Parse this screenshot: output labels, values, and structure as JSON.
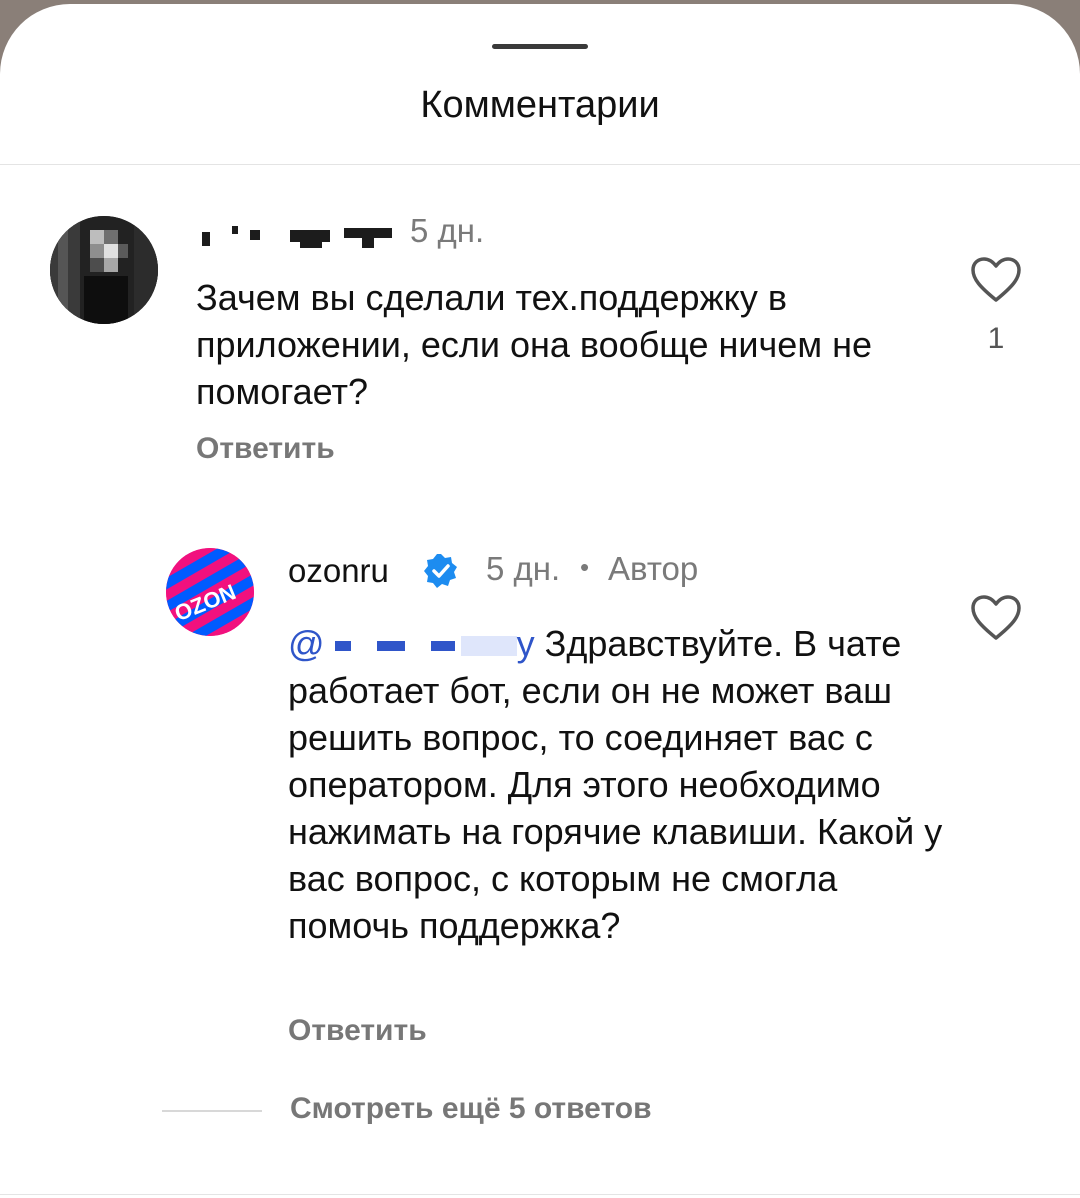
{
  "header": {
    "title": "Комментарии"
  },
  "comments": [
    {
      "username": "",
      "time": "5 дн.",
      "text": "Зачем вы сделали тех.поддержку в приложении, если она вообще ничем не помогает?",
      "reply_label": "Ответить",
      "likes": "1",
      "like_icon": "heart-outline-icon"
    },
    {
      "username": "ozonru",
      "verified_icon": "verified-badge-icon",
      "time": "5 дн.",
      "separator": "•",
      "author_label": "Автор",
      "mention_prefix": "@",
      "mention_tail": "у",
      "text": "Здравствуйте. В чате работает бот, если он не может ваш решить вопрос, то соединяет вас с оператором. Для этого необходимо нажимать на горячие клавиши. Какой у вас вопрос, с которым не смогла помочь поддержка?",
      "reply_label": "Ответить",
      "avatar_text": "OZON",
      "like_icon": "heart-outline-icon",
      "brand_colors": {
        "pink": "#f1117e",
        "blue": "#005bff"
      }
    }
  ],
  "more_replies": "Смотреть ещё 5 ответов",
  "colors": {
    "accent": "#2f55c9",
    "muted": "#777777",
    "verified": "#1d8cf0"
  }
}
